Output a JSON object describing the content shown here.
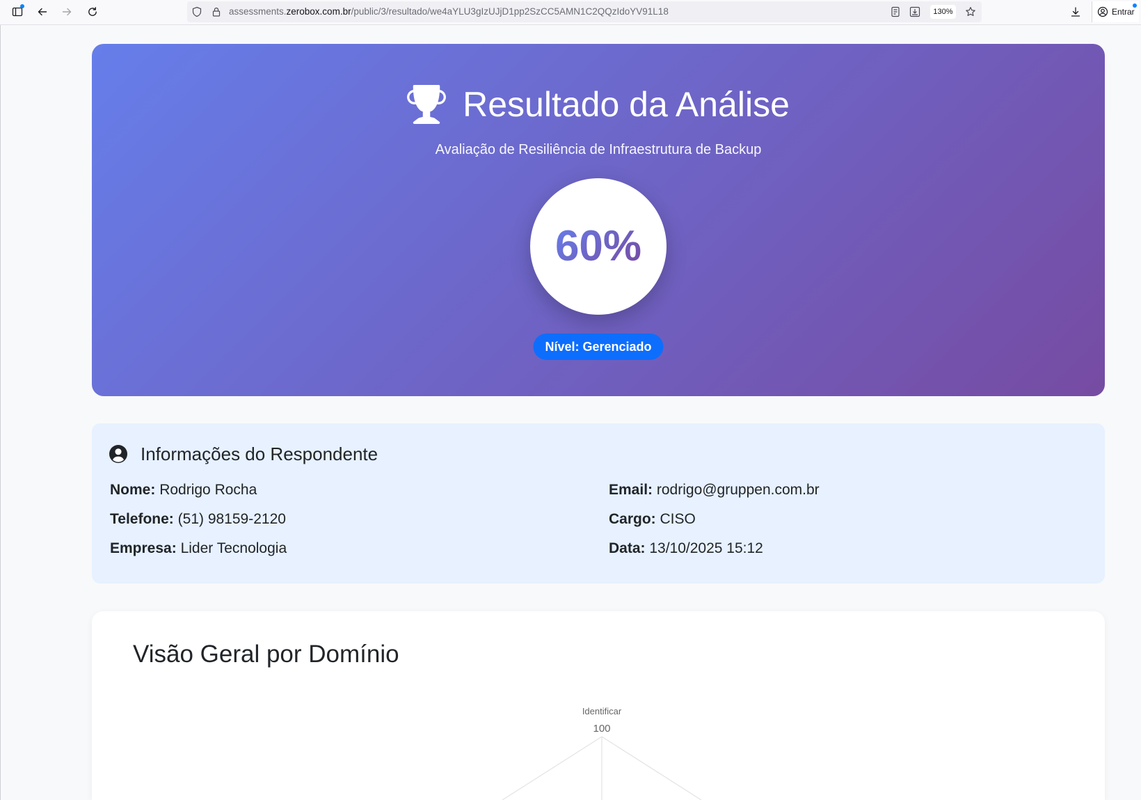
{
  "browser": {
    "url": {
      "prefix": "assessments.",
      "domain": "zerobox.com.br",
      "path": "/public/3/resultado/we4aYLU3gIzUJjD1pp2SzCC5AMN1C2QQzIdoYV91L18"
    },
    "zoom_level": "130%",
    "account_button_label": "Entrar",
    "icons": [
      "sidebar-icon",
      "back-arrow-icon",
      "forward-arrow-icon",
      "reload-icon",
      "shield-icon",
      "lock-icon",
      "reader-view-icon",
      "save-page-icon",
      "star-icon",
      "download-icon",
      "account-icon"
    ]
  },
  "hero": {
    "icon": "trophy-icon",
    "title": "Resultado da Análise",
    "subtitle": "Avaliação de Resiliência de Infraestrutura de Backup",
    "score": "60%",
    "level_badge": "Nível: Gerenciado"
  },
  "respondent": {
    "icon": "person-circle-icon",
    "title": "Informações do Respondente",
    "left_fields": [
      {
        "label": "Nome:",
        "value": "Rodrigo Rocha"
      },
      {
        "label": "Telefone:",
        "value": "(51) 98159-2120"
      },
      {
        "label": "Empresa:",
        "value": "Lider Tecnologia"
      }
    ],
    "right_fields": [
      {
        "label": "Email:",
        "value": "rodrigo@gruppen.com.br"
      },
      {
        "label": "Cargo:",
        "value": "CISO"
      },
      {
        "label": "Data:",
        "value": "13/10/2025 15:12"
      }
    ]
  },
  "chart_data": {
    "type": "radar",
    "title": "Visão Geral por Domínio",
    "axis_labels": [
      "Identificar"
    ],
    "tick_labels": [
      "100"
    ],
    "r_max": 100
  },
  "colors": {
    "hero_gradient_start": "#667eea",
    "hero_gradient_end": "#764ba2",
    "level_badge": "#0d6efd",
    "respondent_card_background": "#e7f1ff",
    "page_background": "#f8f9fa"
  }
}
